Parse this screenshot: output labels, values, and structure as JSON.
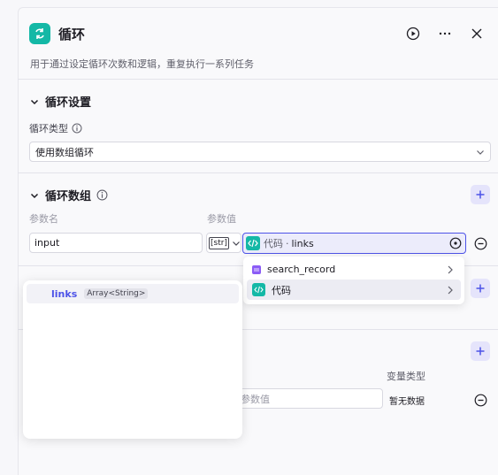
{
  "header": {
    "title": "循环",
    "description": "用于通过设定循环次数和逻辑，重复执行一系列任务",
    "icon": "loop-icon",
    "actions": [
      "run-icon",
      "more-icon",
      "close-icon"
    ]
  },
  "loop_settings": {
    "title": "循环设置",
    "type_label": "循环类型",
    "type_value": "使用数组循环"
  },
  "loop_array": {
    "title": "循环数组",
    "col_name": "参数名",
    "col_value": "参数值",
    "param_name": "input",
    "type_tag": "[str]",
    "value_source": "代码",
    "value_separator": "·",
    "value_field": "links"
  },
  "dropdown": {
    "items": [
      {
        "label": "search_record",
        "icon": "database-icon"
      },
      {
        "label": "代码",
        "icon": "code-icon"
      }
    ]
  },
  "submenu": {
    "item_label": "links",
    "item_type": "Array<String>"
  },
  "variables": {
    "col_type": "变量类型",
    "value_placeholder": "参数值",
    "type_empty": "暂无数据"
  },
  "colors": {
    "accent": "#4d53e8",
    "teal": "#14b8a6",
    "purple": "#8b5cf6"
  }
}
